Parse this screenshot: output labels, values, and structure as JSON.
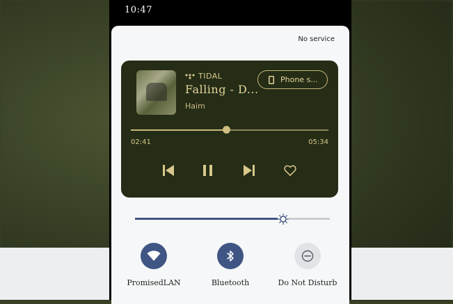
{
  "status_bar": {
    "time": "10:47"
  },
  "quick_settings": {
    "carrier": "No service",
    "media": {
      "provider": "TIDAL",
      "title": "Falling - D...",
      "artist": "Haim",
      "output_device": "Phone s...",
      "elapsed": "02:41",
      "duration": "05:34",
      "progress_fraction": 0.482
    },
    "brightness": {
      "level_fraction": 0.76
    },
    "tiles": [
      {
        "label": "PromisedLAN",
        "icon": "wifi-icon",
        "active": true
      },
      {
        "label": "Bluetooth",
        "icon": "bluetooth-icon",
        "active": true
      },
      {
        "label": "Do Not Disturb",
        "icon": "do-not-disturb-icon",
        "active": false
      }
    ]
  },
  "colors": {
    "media_background": "#252d16",
    "media_accent": "#d9c88c",
    "tile_active": "#3f5583",
    "tile_inactive": "#e2e3e6"
  }
}
